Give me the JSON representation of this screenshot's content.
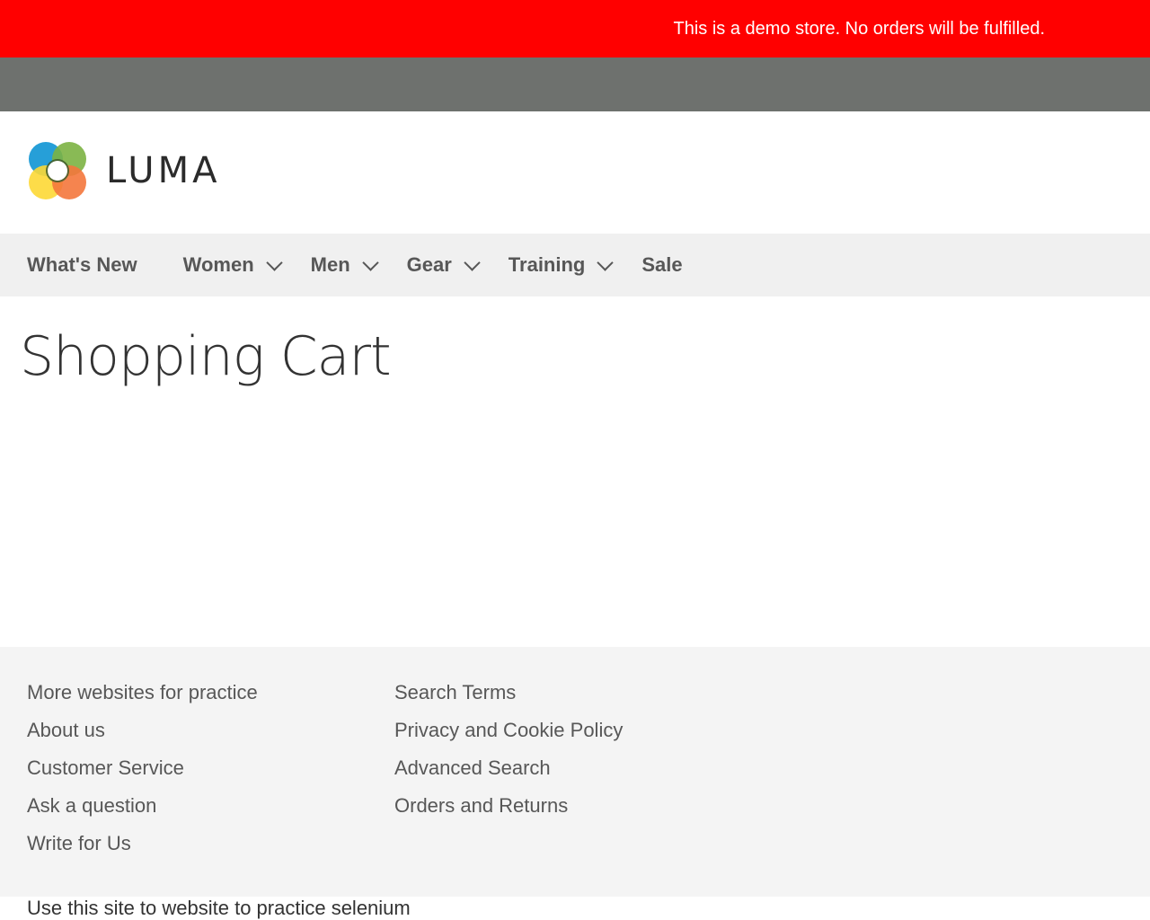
{
  "notice": {
    "text": "This is a demo store. No orders will be fulfilled.",
    "bg_color": "#ff0000"
  },
  "header": {
    "logo_text": "LUMA",
    "logo_icon": "luma-logo-icon"
  },
  "nav": {
    "items": [
      {
        "label": "What's New",
        "has_submenu": false
      },
      {
        "label": "Women",
        "has_submenu": true
      },
      {
        "label": "Men",
        "has_submenu": true
      },
      {
        "label": "Gear",
        "has_submenu": true
      },
      {
        "label": "Training",
        "has_submenu": true
      },
      {
        "label": "Sale",
        "has_submenu": false
      }
    ]
  },
  "main": {
    "title": "Shopping Cart"
  },
  "footer": {
    "col1": [
      "More websites for practice",
      "About us",
      "Customer Service",
      "Ask a question",
      "Write for Us"
    ],
    "col2": [
      "Search Terms",
      "Privacy and Cookie Policy",
      "Advanced Search",
      "Orders and Returns"
    ],
    "note": "Use this site to website to practice selenium"
  }
}
